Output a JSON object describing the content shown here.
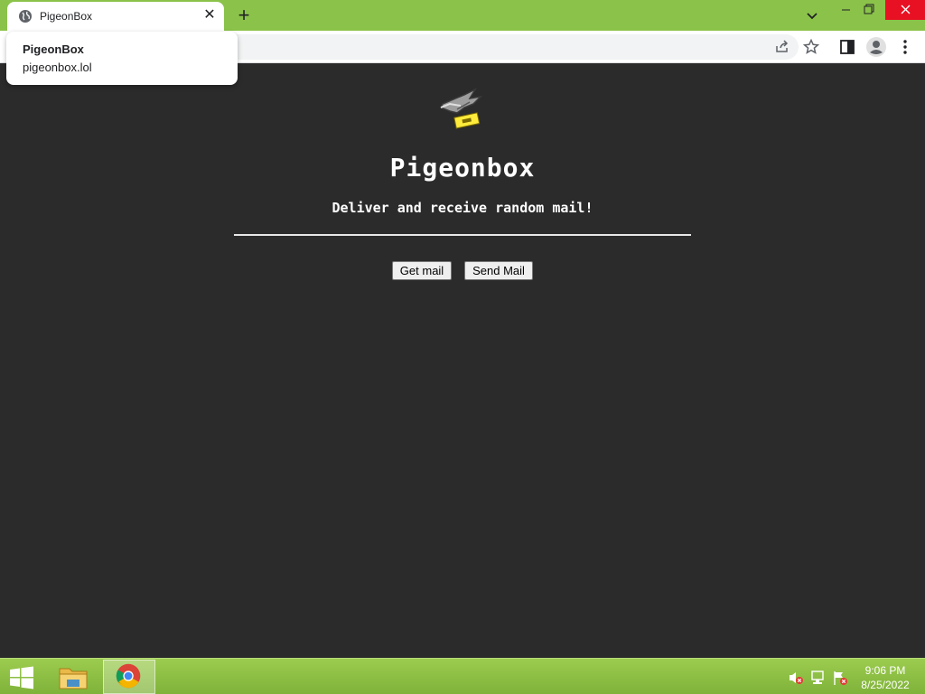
{
  "browser": {
    "tab": {
      "title": "PigeonBox",
      "close_glyph": "✕"
    },
    "new_tab_glyph": "+",
    "hovercard": {
      "title": "PigeonBox",
      "url": "pigeonbox.lol"
    },
    "accent_color": "#8bc34a"
  },
  "page": {
    "title": "Pigeonbox",
    "tagline": "Deliver and receive random mail!",
    "buttons": {
      "get_mail": "Get mail",
      "send_mail": "Send Mail"
    },
    "background_color": "#2b2b2b"
  },
  "taskbar": {
    "time": "9:06 PM",
    "date": "8/25/2022",
    "tray_icons": [
      "speaker-muted-icon",
      "network-icon",
      "action-center-flag-icon"
    ]
  }
}
